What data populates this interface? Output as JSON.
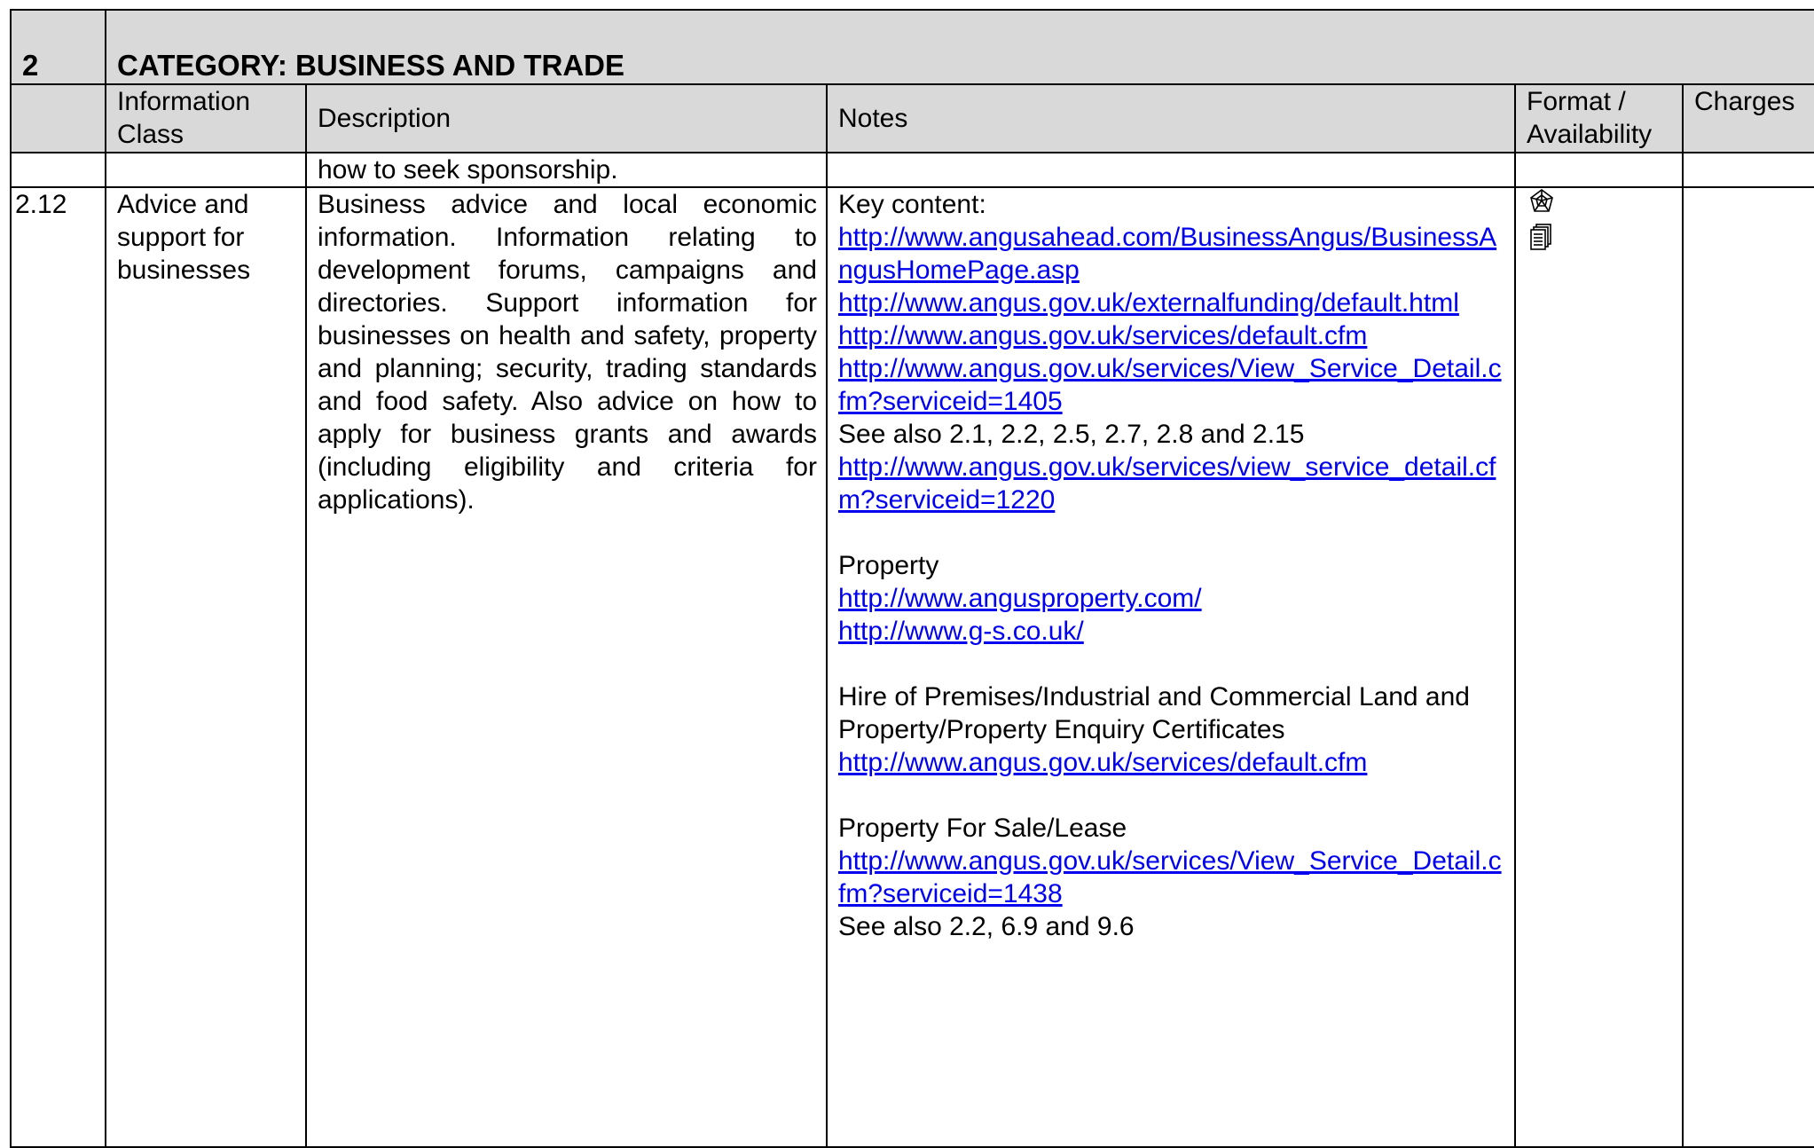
{
  "category": {
    "number": "2",
    "title": "CATEGORY: BUSINESS AND TRADE"
  },
  "headers": {
    "info_class": "Information Class",
    "description": "Description",
    "notes": "Notes",
    "format": "Format / Availability",
    "charges": "Charges"
  },
  "continuation": {
    "description": "how to seek sponsorship."
  },
  "entry": {
    "number": "2.12",
    "info_class": "Advice and support for businesses",
    "description": "Business advice and local economic information. Information relating to development forums, campaigns and directories. Support information for businesses on health and safety, property and planning; security, trading standards and food safety. Also advice on how to apply for business grants and awards (including eligibility and criteria for applications).",
    "notes": {
      "key_content_label": "Key content:",
      "link1": "http://www.angusahead.com/BusinessAngus/BusinessAngusHomePage.asp",
      "link2": "http://www.angus.gov.uk/externalfunding/default.html",
      "link3": "http://www.angus.gov.uk/services/default.cfm",
      "link4": "http://www.angus.gov.uk/services/View_Service_Detail.cfm?serviceid=1405",
      "see_also_1": "See also 2.1, 2.2, 2.5, 2.7, 2.8 and 2.15",
      "link5": "http://www.angus.gov.uk/services/view_service_detail.cfm?serviceid=1220",
      "property_label": "Property",
      "link6": "http://www.angusproperty.com/",
      "link7": "http://www.g-s.co.uk/",
      "hire_label": "Hire of Premises/Industrial  and Commercial Land and Property/Property Enquiry Certificates",
      "link8": "http://www.angus.gov.uk/services/default.cfm",
      "sale_label": "Property For Sale/Lease",
      "link9": "http://www.angus.gov.uk/services/View_Service_Detail.cfm?serviceid=1438",
      "see_also_2": "See also 2.2, 6.9 and 9.6"
    },
    "format_icons": [
      "web-icon",
      "document-icon"
    ],
    "charges": ""
  },
  "colors": {
    "header_bg": "#d9d9d9",
    "link": "#0000ee",
    "border": "#000000"
  }
}
